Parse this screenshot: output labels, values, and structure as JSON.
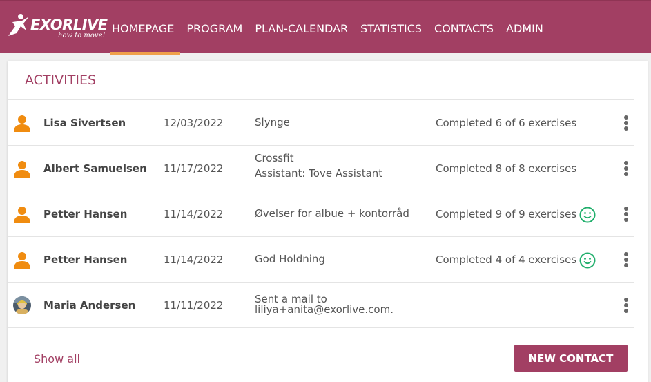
{
  "app": {
    "logo_word": "EXORLIVE",
    "logo_tagline": "how to move!",
    "brand_color": "#a23f63",
    "accent_color": "#f0a04b"
  },
  "nav": {
    "items": [
      {
        "label": "HOMEPAGE",
        "active": true
      },
      {
        "label": "PROGRAM",
        "active": false
      },
      {
        "label": "PLAN-CALENDAR",
        "active": false
      },
      {
        "label": "STATISTICS",
        "active": false
      },
      {
        "label": "CONTACTS",
        "active": false
      },
      {
        "label": "ADMIN",
        "active": false
      }
    ]
  },
  "activities": {
    "title": "ACTIVITIES",
    "rows": [
      {
        "avatar": "person-icon",
        "name": "Lisa Sivertsen",
        "date": "12/03/2022",
        "desc": "Slynge",
        "desc2": "",
        "status": "Completed 6 of 6 exercises",
        "smiley": false
      },
      {
        "avatar": "person-icon",
        "name": "Albert Samuelsen",
        "date": "11/17/2022",
        "desc": "Crossfit",
        "desc2": "Assistant: Tove Assistant",
        "status": "Completed 8 of 8 exercises",
        "smiley": false
      },
      {
        "avatar": "person-icon",
        "name": "Petter Hansen",
        "date": "11/14/2022",
        "desc": "Øvelser for albue + kontorråd",
        "desc2": "",
        "status": "Completed 9 of 9 exercises",
        "smiley": true
      },
      {
        "avatar": "person-icon",
        "name": "Petter Hansen",
        "date": "11/14/2022",
        "desc": "God Holdning",
        "desc2": "",
        "status": "Completed 4 of 4 exercises",
        "smiley": true
      },
      {
        "avatar": "photo-avatar",
        "name": "Maria Andersen",
        "date": "11/11/2022",
        "desc": "Sent a mail to",
        "desc2": "liliya+anita@exorlive.com.",
        "status": "",
        "smiley": false
      }
    ],
    "show_all": "Show all",
    "new_contact": "NEW CONTACT"
  }
}
